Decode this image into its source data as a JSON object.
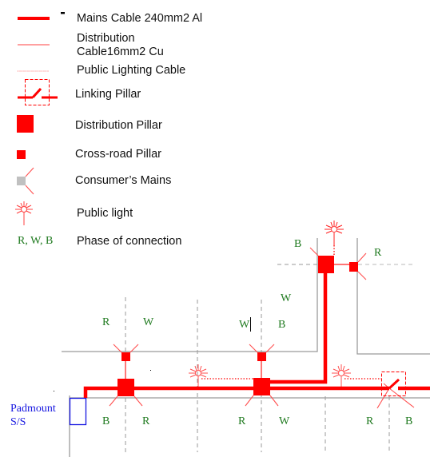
{
  "legend": {
    "items": [
      {
        "symbol": "mains-cable",
        "label": "Mains Cable 240mm2 Al"
      },
      {
        "symbol": "distribution-cable",
        "label_line1": "Distribution",
        "label_line2": "Cable16mm2 Cu"
      },
      {
        "symbol": "public-lighting-cable",
        "label": "Public Lighting Cable"
      },
      {
        "symbol": "linking-pillar",
        "label": "Linking Pillar"
      },
      {
        "symbol": "distribution-pillar",
        "label": "Distribution Pillar"
      },
      {
        "symbol": "cross-road-pillar",
        "label": "Cross-road Pillar"
      },
      {
        "symbol": "consumers-mains",
        "label": "Consumer’s Mains"
      },
      {
        "symbol": "public-light",
        "label": "Public light"
      },
      {
        "symbol": "phase-label",
        "sample": "R, W, B",
        "label": "Phase of connection"
      }
    ]
  },
  "substation": {
    "line1": "Padmount",
    "line2": "S/S"
  },
  "phases": {
    "p1": "R",
    "p2": "W",
    "p3": "W",
    "p4": "B",
    "p5": "W",
    "p6": "B",
    "p7": "R",
    "p8": "R",
    "p9": "W",
    "p10": "R",
    "p11": "B",
    "p12": "B",
    "p13": "R"
  },
  "colors": {
    "cable": "#ff0000",
    "road": "#9a9a9a",
    "phase_text": "#1f7a1f",
    "substation": "#1515e0",
    "consumer_square": "#c0c0c0"
  }
}
